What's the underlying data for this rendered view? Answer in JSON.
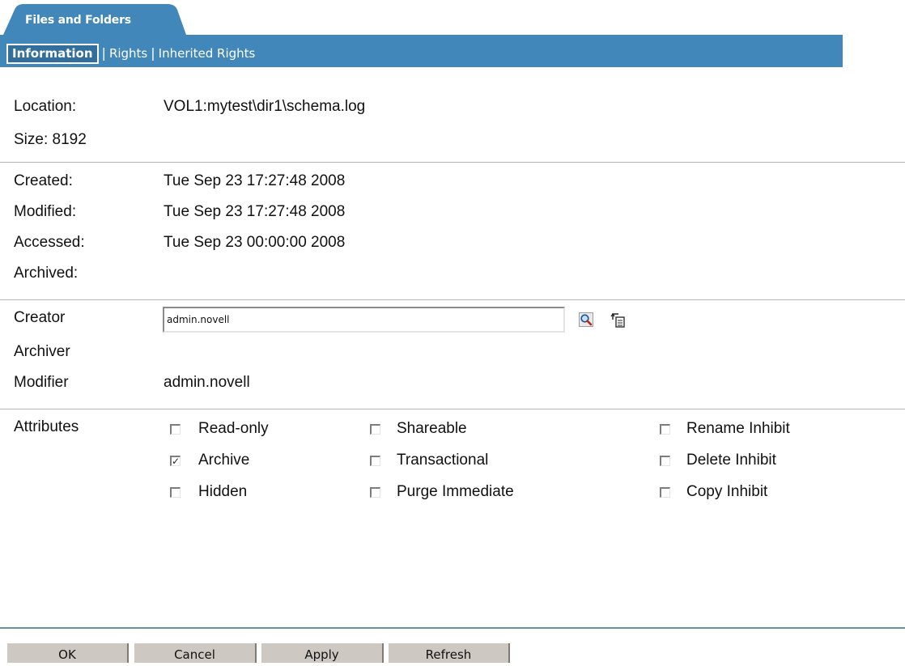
{
  "header": {
    "tab_label": "Files and Folders",
    "subnav": {
      "active": "Information",
      "links": [
        "Rights",
        "Inherited Rights"
      ]
    }
  },
  "info": {
    "location_label": "Location:",
    "location_value": "VOL1:mytest\\dir1\\schema.log",
    "size_label": "Size: 8192"
  },
  "dates": {
    "created_label": "Created:",
    "created_value": "Tue Sep 23 17:27:48 2008",
    "modified_label": "Modified:",
    "modified_value": "Tue Sep 23 17:27:48 2008",
    "accessed_label": "Accessed:",
    "accessed_value": "Tue Sep 23 00:00:00 2008",
    "archived_label": "Archived:"
  },
  "people": {
    "creator_label": "Creator",
    "creator_value": "admin.novell",
    "archiver_label": "Archiver",
    "modifier_label": "Modifier",
    "modifier_value": "admin.novell",
    "browse_icon": "search-icon",
    "history_icon": "object-history-icon"
  },
  "attributes": {
    "label": "Attributes",
    "items": [
      {
        "label": "Read-only",
        "checked": false
      },
      {
        "label": "Archive",
        "checked": true
      },
      {
        "label": "Hidden",
        "checked": false
      },
      {
        "label": "Shareable",
        "checked": false
      },
      {
        "label": "Transactional",
        "checked": false
      },
      {
        "label": "Purge Immediate",
        "checked": false
      },
      {
        "label": "Rename Inhibit",
        "checked": false
      },
      {
        "label": "Delete Inhibit",
        "checked": false
      },
      {
        "label": "Copy Inhibit",
        "checked": false
      }
    ]
  },
  "buttons": {
    "ok": "OK",
    "cancel": "Cancel",
    "apply": "Apply",
    "refresh": "Refresh"
  },
  "colors": {
    "header_blue": "#4287ba",
    "button_gray": "#cdc9c2"
  }
}
